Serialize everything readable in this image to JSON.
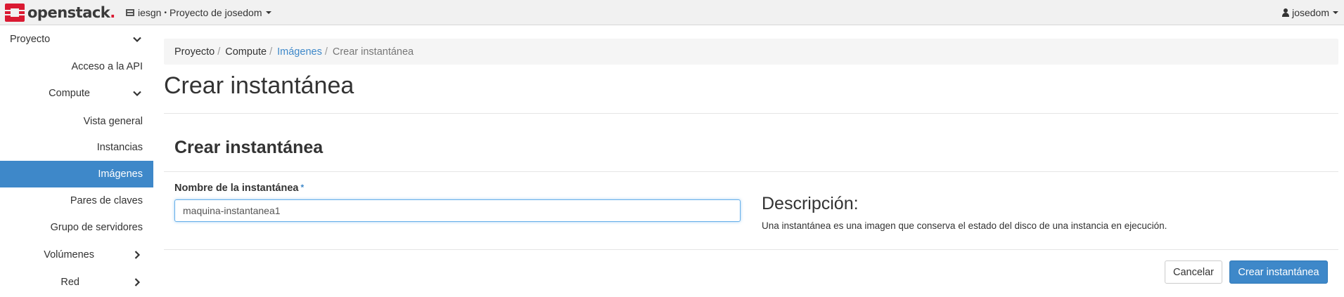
{
  "topbar": {
    "brand": "openstack",
    "brand_dot": ".",
    "domain": "iesgn",
    "separator": "•",
    "project": "Proyecto de josedom",
    "user": "josedom"
  },
  "sidebar": {
    "items": [
      {
        "label": "Proyecto"
      },
      {
        "label": "Acceso a la API"
      },
      {
        "label": "Compute"
      },
      {
        "label": "Vista general"
      },
      {
        "label": "Instancias"
      },
      {
        "label": "Imágenes"
      },
      {
        "label": "Pares de claves"
      },
      {
        "label": "Grupo de servidores"
      },
      {
        "label": "Volúmenes"
      },
      {
        "label": "Red"
      }
    ],
    "active": "Imágenes"
  },
  "breadcrumb": {
    "items": [
      "Proyecto",
      "Compute",
      "Imágenes",
      "Crear instantánea"
    ],
    "separator": "/"
  },
  "page": {
    "title": "Crear instantánea",
    "form_title": "Crear instantánea",
    "field_label": "Nombre de la instantánea",
    "required_mark": "*",
    "field_value": "maquina-instantanea1",
    "description_title": "Descripción:",
    "description_text": "Una instantánea es una imagen que conserva el estado del disco de una instancia en ejecución.",
    "cancel_label": "Cancelar",
    "submit_label": "Crear instantánea"
  },
  "colors": {
    "accent": "#3e88c9",
    "brand_red": "#da1a32"
  }
}
